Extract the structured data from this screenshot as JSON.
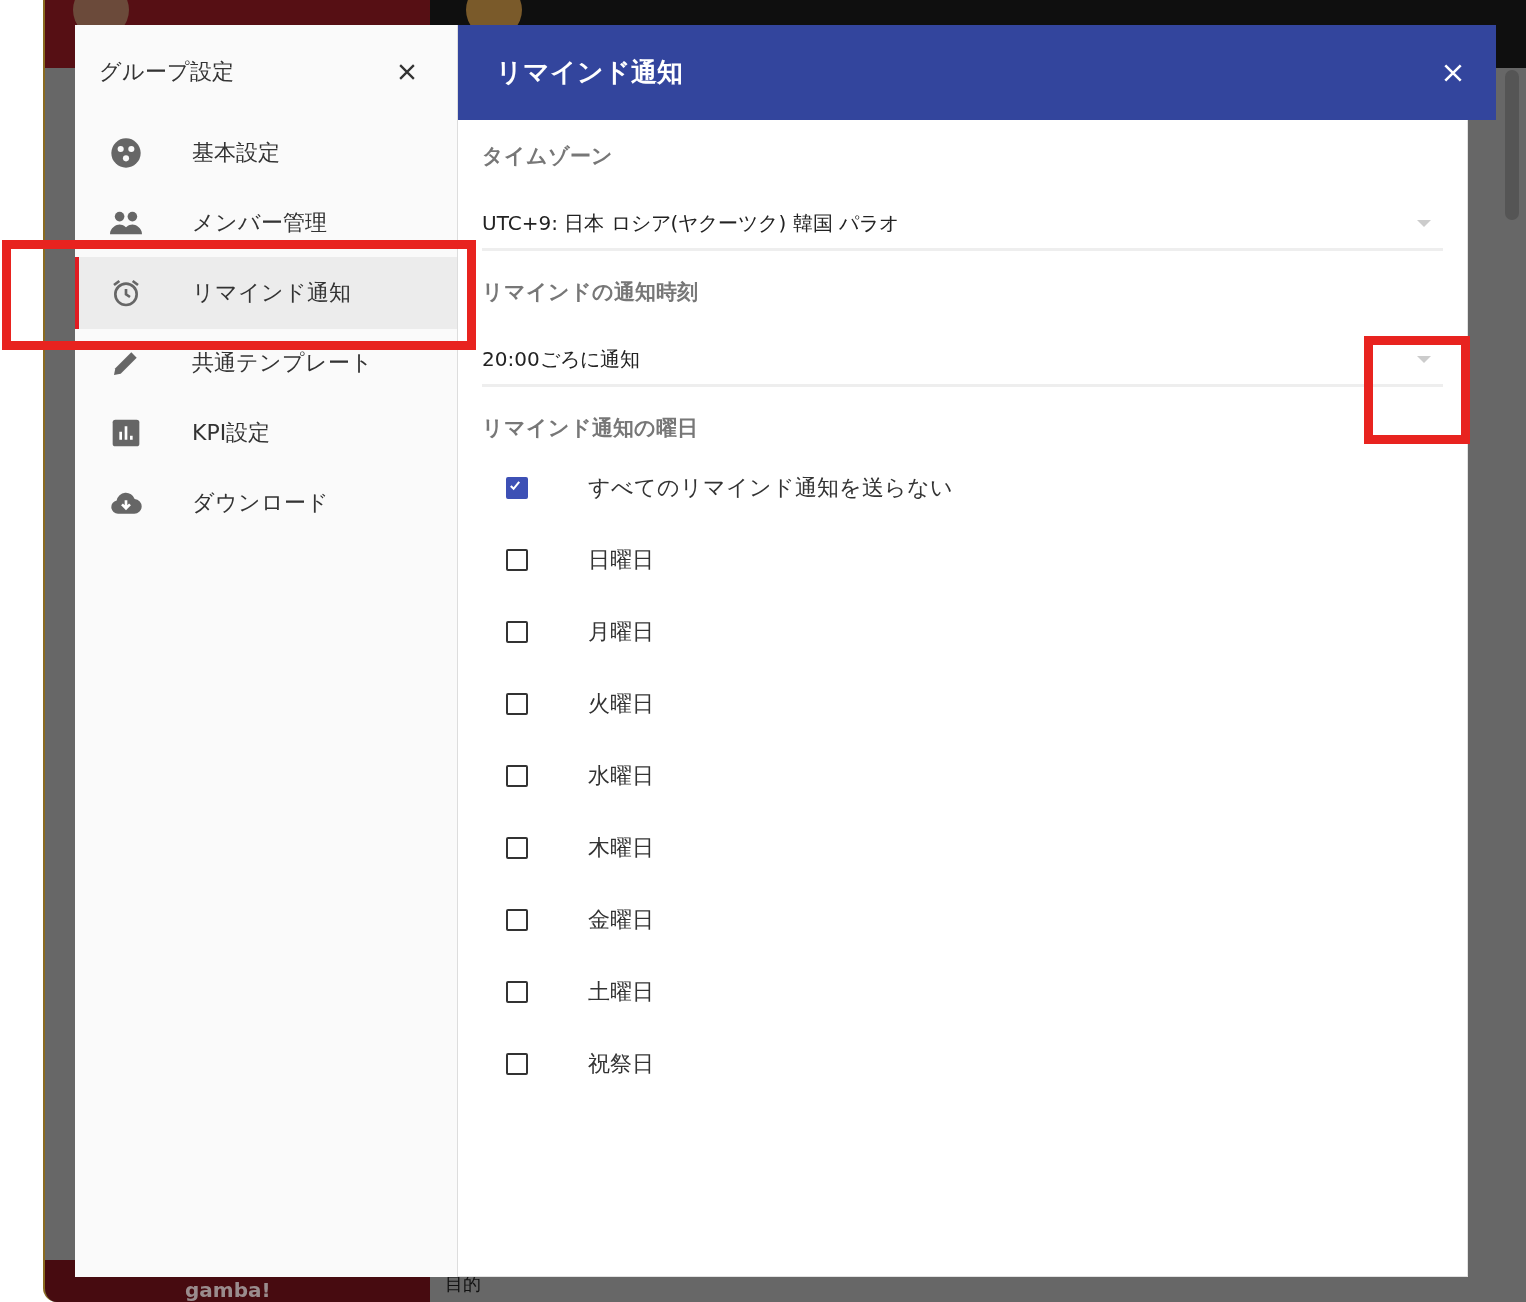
{
  "background": {
    "logo": "gamba!",
    "label": "目的"
  },
  "settings_menu": {
    "title": "グループ設定",
    "items": [
      {
        "label": "基本設定",
        "selected": false
      },
      {
        "label": "メンバー管理",
        "selected": false
      },
      {
        "label": "リマインド通知",
        "selected": true
      },
      {
        "label": "共通テンプレート",
        "selected": false
      },
      {
        "label": "KPI設定",
        "selected": false
      },
      {
        "label": "ダウンロード",
        "selected": false
      }
    ]
  },
  "panel": {
    "title": "リマインド通知",
    "fields": [
      {
        "label": "タイムゾーン",
        "value": "UTC+9: 日本 ロシア(ヤクーツク) 韓国 パラオ"
      },
      {
        "label": "リマインドの通知時刻",
        "value": "20:00ごろに通知"
      }
    ],
    "days_label": "リマインド通知の曜日",
    "days": [
      {
        "label": "すべてのリマインド通知を送らない",
        "checked": true
      },
      {
        "label": "日曜日",
        "checked": false
      },
      {
        "label": "月曜日",
        "checked": false
      },
      {
        "label": "火曜日",
        "checked": false
      },
      {
        "label": "水曜日",
        "checked": false
      },
      {
        "label": "木曜日",
        "checked": false
      },
      {
        "label": "金曜日",
        "checked": false
      },
      {
        "label": "土曜日",
        "checked": false
      },
      {
        "label": "祝祭日",
        "checked": false
      }
    ]
  }
}
